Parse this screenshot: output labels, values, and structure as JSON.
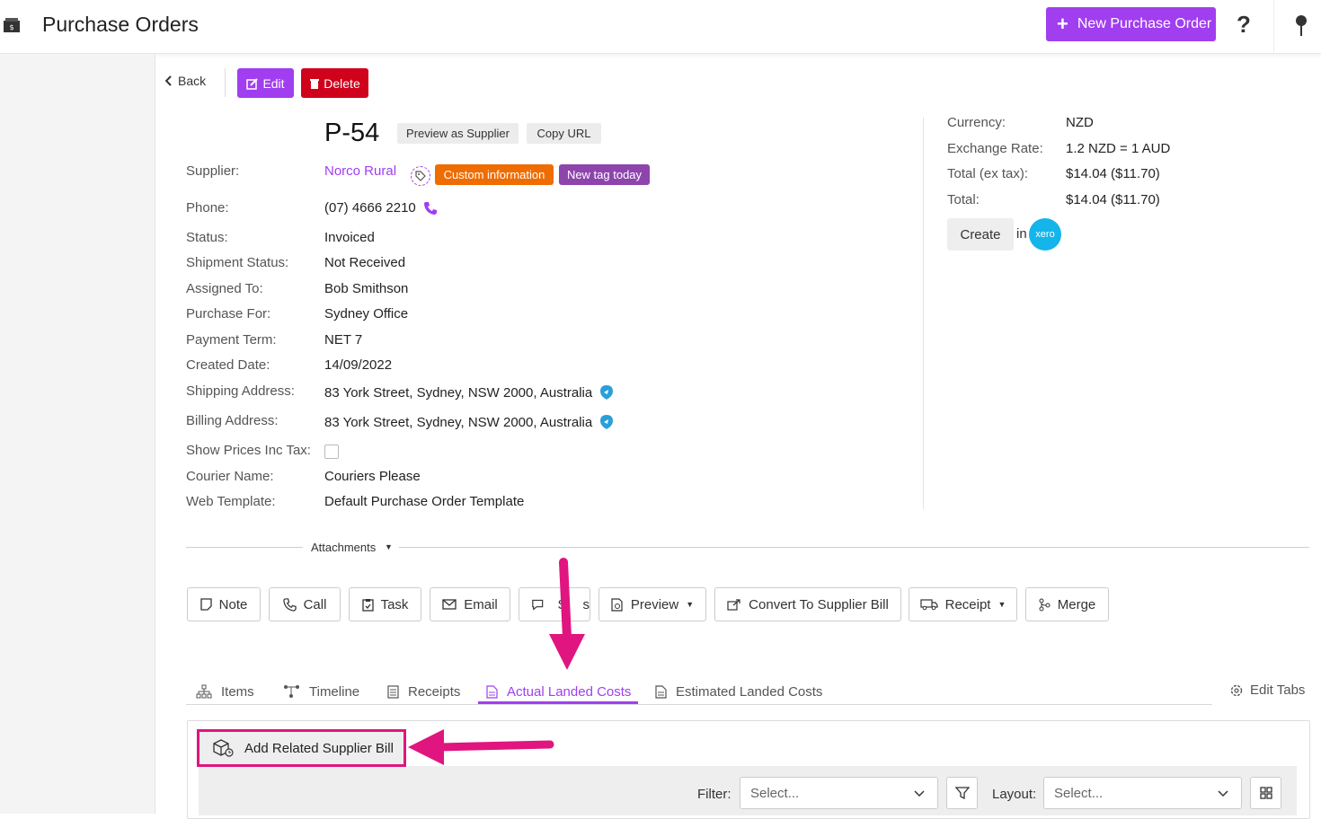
{
  "header": {
    "title": "Purchase Orders",
    "new_button_label": "New Purchase Order",
    "help_label": "?"
  },
  "toolbar": {
    "back_label": "Back",
    "edit_label": "Edit",
    "delete_label": "Delete"
  },
  "order": {
    "number": "P-54",
    "preview_supplier_label": "Preview as Supplier",
    "copy_url_label": "Copy URL",
    "tags": [
      "Custom information",
      "New tag today"
    ],
    "fields": [
      {
        "label": "Supplier:",
        "value": "Norco Rural"
      },
      {
        "label": "Phone:",
        "value": "(07) 4666 2210"
      },
      {
        "label": "Status:",
        "value": "Invoiced"
      },
      {
        "label": "Shipment Status:",
        "value": "Not Received"
      },
      {
        "label": "Assigned To:",
        "value": "Bob Smithson"
      },
      {
        "label": "Purchase For:",
        "value": "Sydney Office"
      },
      {
        "label": "Payment Term:",
        "value": "NET 7"
      },
      {
        "label": "Created Date:",
        "value": "14/09/2022"
      },
      {
        "label": "Shipping Address:",
        "value": "83 York Street, Sydney, NSW 2000, Australia"
      },
      {
        "label": "Billing Address:",
        "value": "83 York Street, Sydney, NSW 2000, Australia"
      },
      {
        "label": "Show Prices Inc Tax:",
        "value": ""
      },
      {
        "label": "Courier Name:",
        "value": "Couriers Please"
      },
      {
        "label": "Web Template:",
        "value": "Default Purchase Order Template"
      }
    ]
  },
  "totals": [
    {
      "label": "Currency:",
      "value": "NZD"
    },
    {
      "label": "Exchange Rate:",
      "value": "1.2 NZD = 1 AUD"
    },
    {
      "label": "Total (ex tax):",
      "value": "$14.04 ($11.70)"
    },
    {
      "label": "Total:",
      "value": "$14.04 ($11.70)"
    }
  ],
  "xero": {
    "create_label": "Create",
    "in_label": "in",
    "logo_text": "xero"
  },
  "attachments_label": "Attachments",
  "actions": [
    "Note",
    "Call",
    "Task",
    "Email",
    "S",
    "s",
    "Preview",
    "Convert To Supplier Bill",
    "Receipt",
    "Merge"
  ],
  "tabs": [
    "Items",
    "Timeline",
    "Receipts",
    "Actual Landed Costs",
    "Estimated Landed Costs"
  ],
  "edit_tabs_label": "Edit Tabs",
  "panel": {
    "add_bill_label": "Add Related Supplier Bill",
    "filter_label": "Filter:",
    "filter_placeholder": "Select...",
    "layout_label": "Layout:",
    "layout_placeholder": "Select..."
  },
  "colors": {
    "accent": "#a03ef0",
    "danger": "#d0021b",
    "annotation": "#e0157f",
    "xero": "#13b5ea"
  }
}
